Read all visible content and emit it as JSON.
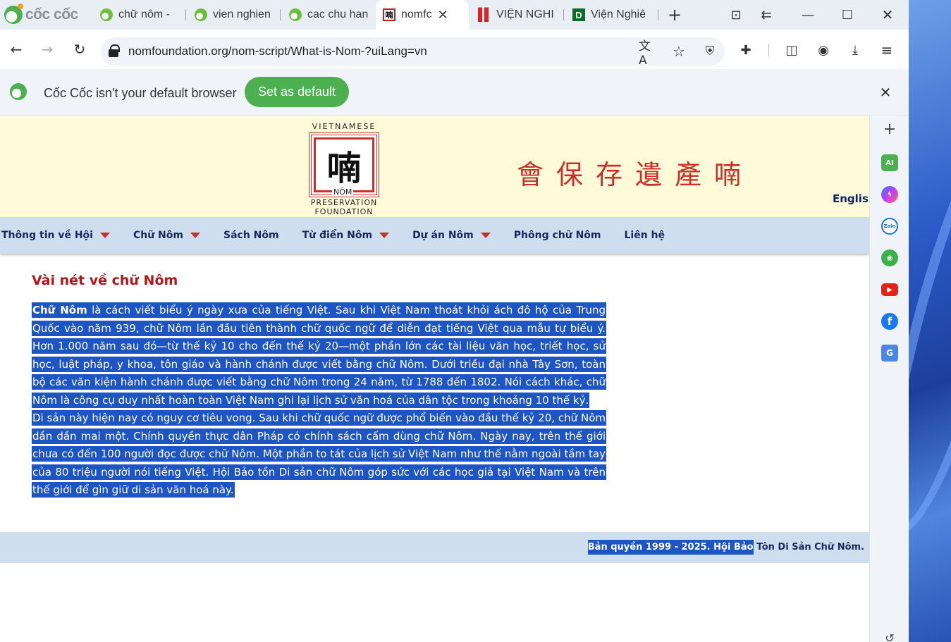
{
  "browser": {
    "brand": "cốc cốc",
    "tabs": [
      {
        "title": "chữ nôm -",
        "favicon": "coccoc"
      },
      {
        "title": "vien nghien",
        "favicon": "coccoc"
      },
      {
        "title": "cac chu han",
        "favicon": "coccoc"
      },
      {
        "title": "nomfc",
        "favicon": "nom",
        "active": true
      },
      {
        "title": "VIỆN NGHI",
        "favicon": "vien"
      },
      {
        "title": "Viện Nghiê",
        "favicon": "d"
      }
    ],
    "new_tab": "+",
    "url": "nomfoundation.org/nom-script/What-is-Nom-?uiLang=vn"
  },
  "infobar": {
    "message": "Cốc Cốc isn't your default browser",
    "button": "Set as default"
  },
  "site": {
    "logo": {
      "top_text": "VIETNAMESE",
      "glyph": "喃",
      "nom_text": "NÔM",
      "bottom_line1": "PRESERVATION",
      "bottom_line2": "FOUNDATION"
    },
    "han_title": "會保存遺產喃",
    "language_link": "Englis",
    "menu": [
      {
        "label": "Thông tin về Hội",
        "has_dropdown": true
      },
      {
        "label": "Chữ Nôm",
        "has_dropdown": true
      },
      {
        "label": "Sách Nôm",
        "has_dropdown": false
      },
      {
        "label": "Từ điển Nôm",
        "has_dropdown": true
      },
      {
        "label": "Dự án Nôm",
        "has_dropdown": true
      },
      {
        "label": "Phông chữ Nôm",
        "has_dropdown": false
      },
      {
        "label": "Liên hệ",
        "has_dropdown": false
      }
    ],
    "article": {
      "title": "Vài nét về chữ Nôm",
      "para1_bold": "Chữ Nôm",
      "para1_rest": " là cách viết biểu ý ngày xưa của tiếng Việt. Sau khi Việt Nam thoát khỏi ách đô hộ của Trung Quốc vào năm 939, chữ Nôm lần đầu tiên thành chữ quốc ngữ để diễn đạt tiếng Việt qua mẫu tự biểu ý. Hơn 1.000 năm sau đó—từ thế kỷ 10 cho đến thế kỷ 20—một phần lớn các tài liệu văn học, triết học, sử học, luật pháp, y khoa, tôn giáo và hành chánh được viết bằng chữ Nôm. Dưới triều đại nhà Tây Sơn, toàn bộ các văn kiện hành chánh được viết bằng chữ Nôm trong 24 năm, từ 1788 đến 1802. Nói cách khác, chữ Nôm là công cụ duy nhất hoàn toàn Việt Nam ghi lại lịch sử văn hoá của dân tộc trong khoảng 10 thế kỷ.",
      "para2": "Di sản này hiện nay có nguy cơ tiêu vong. Sau khi chữ quốc ngữ được phổ biến vào đầu thế kỷ 20, chữ Nôm dần dần mai một. Chính quyền thực dân Pháp có chính sách cấm dùng chữ Nôm. Ngày nay, trên thế giới chưa có đến 100 người đọc được chữ Nôm. Một phần to tát của lịch sử Việt Nam như thế nằm ngoài tầm tay của 80 triệu người nói tiếng Việt. Hội Bảo tồn Di sản chữ Nôm góp sức với các học giả tại Việt Nam và trên thế giới để gìn giữ di sản văn hoá này."
    },
    "footer_selected": "Bản quyền 1999 - 2025. Hội Bảo",
    "footer_rest": " Tôn Di Sản Chữ Nôm."
  },
  "sidebar": {
    "ai_label": "AI",
    "zalo_label": "Zalo"
  },
  "colors": {
    "selection": "#1d56c4",
    "menu_bg": "#cfdeef",
    "header_bg": "#fffbd9",
    "accent_red": "#c8302a",
    "infobar_button": "#4caf50"
  }
}
